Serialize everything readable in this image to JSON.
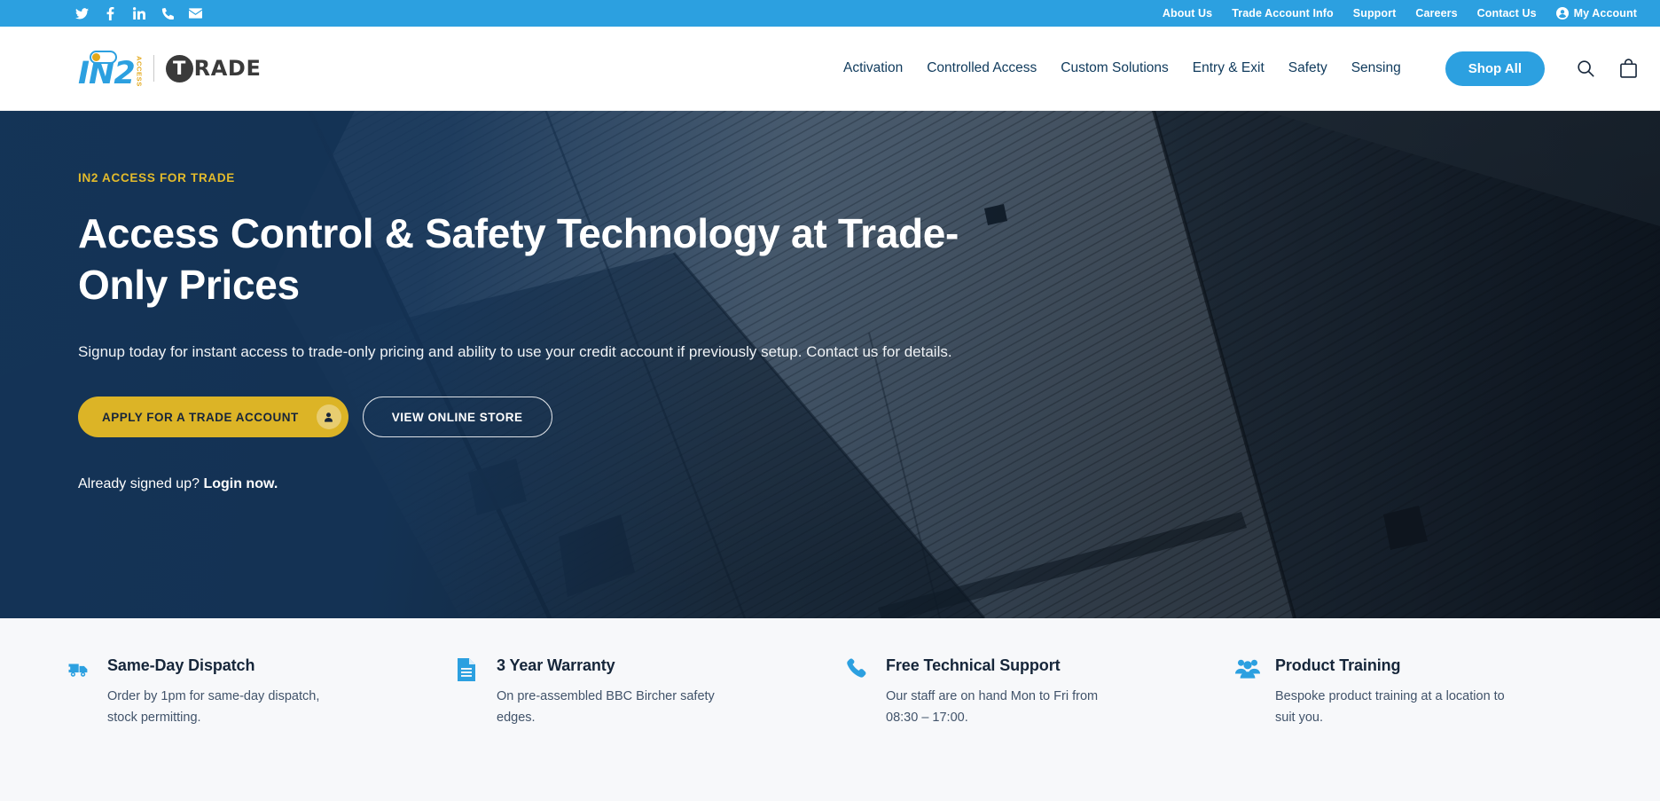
{
  "topbar": {
    "social": [
      {
        "name": "twitter-icon",
        "label": "Twitter"
      },
      {
        "name": "facebook-icon",
        "label": "Facebook"
      },
      {
        "name": "linkedin-icon",
        "label": "LinkedIn"
      },
      {
        "name": "phone-icon",
        "label": "Phone"
      },
      {
        "name": "email-icon",
        "label": "Email"
      }
    ],
    "links": [
      {
        "label": "About Us"
      },
      {
        "label": "Trade Account Info"
      },
      {
        "label": "Support"
      },
      {
        "label": "Careers"
      },
      {
        "label": "Contact Us"
      }
    ],
    "account_label": "My Account",
    "background": "#2ca0e0"
  },
  "header": {
    "logo": {
      "in2": "IN2",
      "access": "ACCESS",
      "t": "T",
      "rade": "RADE",
      "in2_color": "#2ca0e0",
      "access_color": "#e3a81a",
      "trade_color": "#3a3a3a"
    },
    "nav": [
      {
        "label": "Activation"
      },
      {
        "label": "Controlled Access"
      },
      {
        "label": "Custom Solutions"
      },
      {
        "label": "Entry & Exit"
      },
      {
        "label": "Safety"
      },
      {
        "label": "Sensing"
      }
    ],
    "shop_all_label": "Shop All",
    "shop_all_color": "#2ca0e0",
    "nav_color": "#0f3a5c"
  },
  "hero": {
    "eyebrow": "IN2 ACCESS FOR TRADE",
    "eyebrow_color": "#e3bb2c",
    "heading": "Access Control & Safety Technology at Trade-Only Prices",
    "paragraph": "Signup today for instant access to trade-only pricing and ability to use your credit account if previously setup. Contact us for details.",
    "primary_cta": "APPLY FOR A TRADE ACCOUNT",
    "primary_cta_color": "#dcb426",
    "secondary_cta": "VIEW ONLINE STORE",
    "already_text": "Already signed up?",
    "login_link": "Login now."
  },
  "features": [
    {
      "icon": "truck-icon",
      "title": "Same-Day Dispatch",
      "desc": "Order by 1pm for same-day dispatch, stock permitting."
    },
    {
      "icon": "document-icon",
      "title": "3 Year Warranty",
      "desc": "On pre-assembled BBC Bircher safety edges."
    },
    {
      "icon": "phone-icon",
      "title": "Free Technical Support",
      "desc": "Our staff are on hand Mon to Fri from 08:30 – 17:00."
    },
    {
      "icon": "people-icon",
      "title": "Product Training",
      "desc": "Bespoke product training at a location to suit you."
    }
  ]
}
